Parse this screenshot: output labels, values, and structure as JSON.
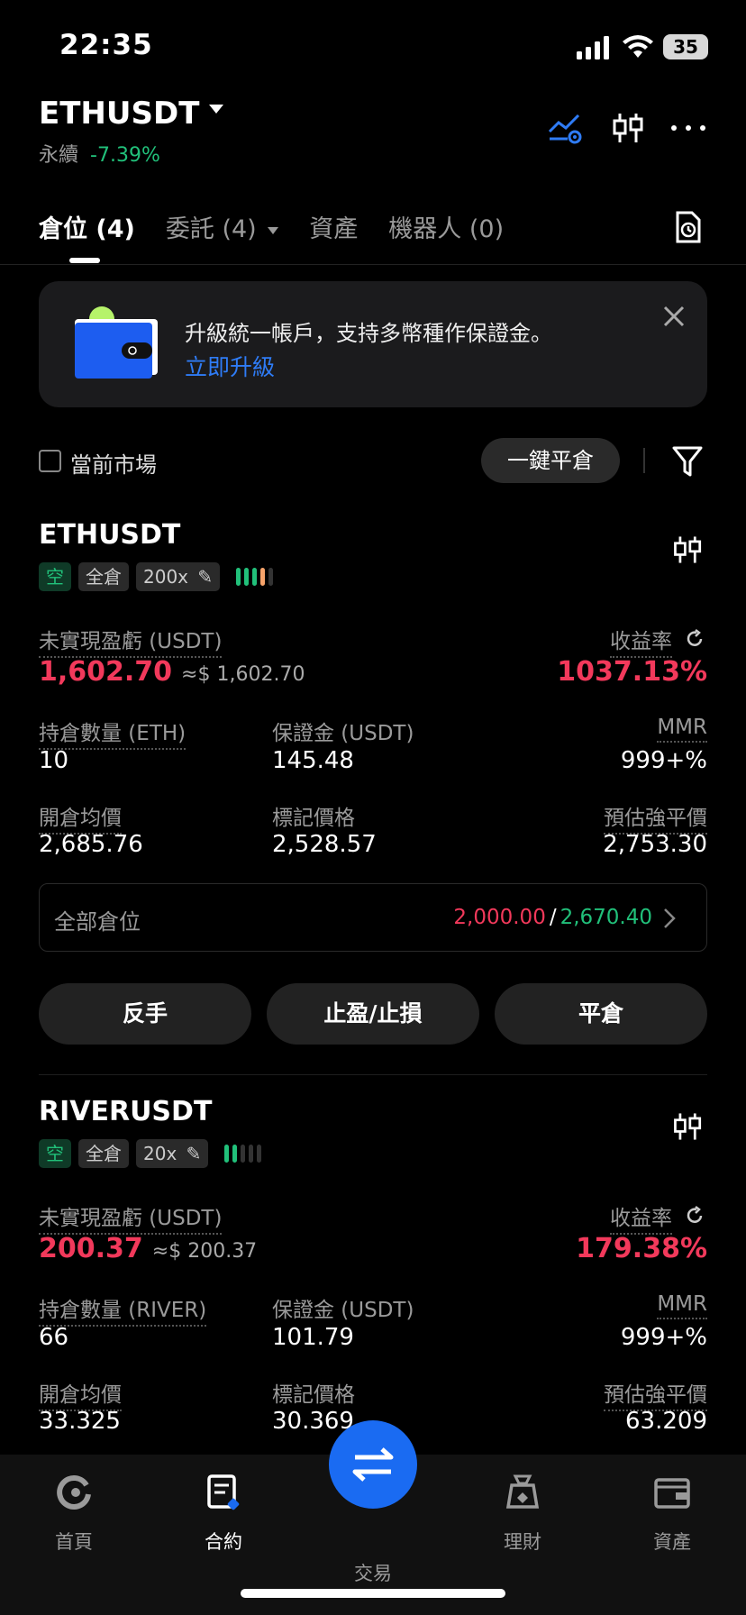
{
  "status": {
    "time": "22:35",
    "battery": "35"
  },
  "header": {
    "pair": "ETHUSDT",
    "type": "永續",
    "change": "-7.39%"
  },
  "tabs": [
    {
      "label": "倉位 (4)"
    },
    {
      "label": "委託 (4)"
    },
    {
      "label": "資產"
    },
    {
      "label": "機器人 (0)"
    }
  ],
  "banner": {
    "title": "升級統一帳戶，支持多幣種作保證金。",
    "link": "立即升級"
  },
  "filter": {
    "checkbox_label": "當前市場",
    "close_all": "一鍵平倉"
  },
  "labels": {
    "unrealized": "未實現盈虧 (USDT)",
    "roi": "收益率",
    "margin": "保證金 (USDT)",
    "mmr": "MMR",
    "entry": "開倉均價",
    "mark": "標記價格",
    "liq": "預估強平價",
    "all_positions": "全部倉位",
    "reverse": "反手",
    "tpsl": "止盈/止損",
    "close": "平倉",
    "slash": "/"
  },
  "positions": [
    {
      "symbol": "ETHUSDT",
      "side": "空",
      "mode": "全倉",
      "leverage": "200x",
      "pnl": "1,602.70",
      "pnl_usd": "≈$ 1,602.70",
      "roi": "1037.13%",
      "qty_label": "持倉數量 (ETH)",
      "qty": "10",
      "margin": "145.48",
      "mmr": "999+%",
      "entry": "2,685.76",
      "mark": "2,528.57",
      "liq": "2,753.30",
      "total_red": "2,000.00",
      "total_green": "2,670.40",
      "risk_level": 4
    },
    {
      "symbol": "RIVERUSDT",
      "side": "空",
      "mode": "全倉",
      "leverage": "20x",
      "pnl": "200.37",
      "pnl_usd": "≈$ 200.37",
      "roi": "179.38%",
      "qty_label": "持倉數量 (RIVER)",
      "qty": "66",
      "margin": "101.79",
      "mmr": "999+%",
      "entry": "33.325",
      "mark": "30.369",
      "liq": "63.209",
      "risk_level": 2
    }
  ],
  "nav": [
    {
      "label": "首頁",
      "icon": "home-icon"
    },
    {
      "label": "合約",
      "icon": "futures-icon"
    },
    {
      "label": "交易",
      "icon": "trade-icon"
    },
    {
      "label": "理財",
      "icon": "earn-icon"
    },
    {
      "label": "資產",
      "icon": "wallet-icon"
    }
  ],
  "colors": {
    "red": "#f2395b",
    "green": "#21c07a",
    "orange": "#f7a46b",
    "blue": "#1a6bf2"
  }
}
